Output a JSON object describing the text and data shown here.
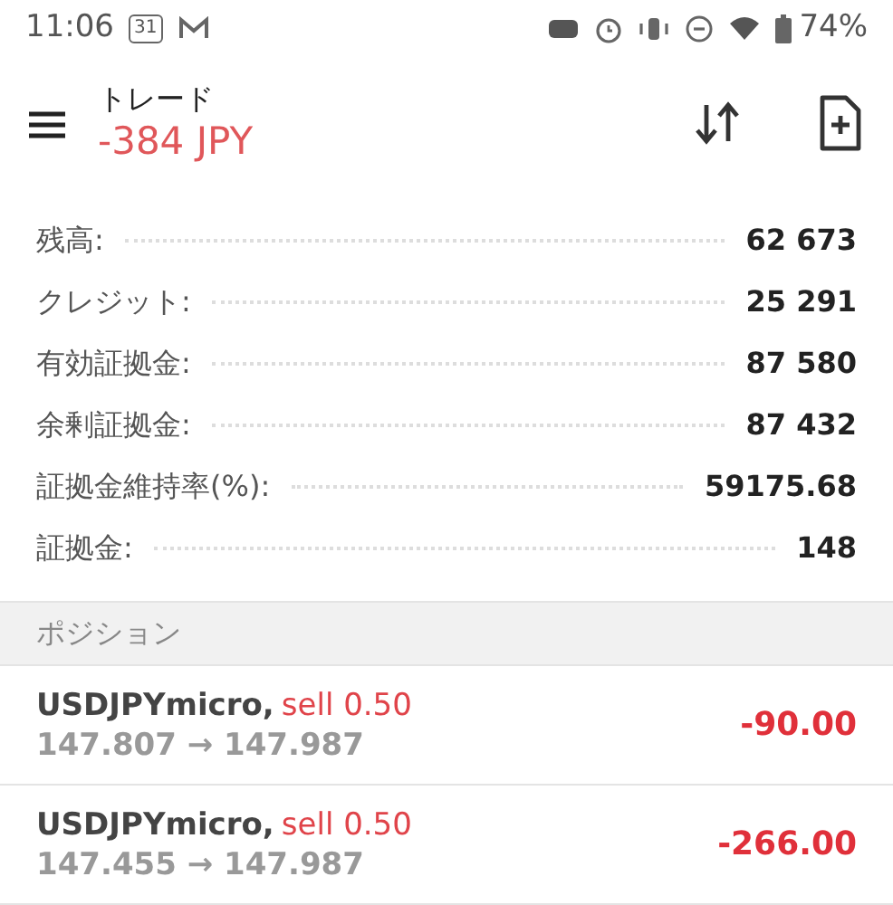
{
  "status_bar": {
    "time": "11:06",
    "calendar_day": "31",
    "battery": "74%"
  },
  "toolbar": {
    "title": "トレード",
    "profit": "-384 JPY"
  },
  "summary": [
    {
      "label": "残高:",
      "value": "62 673"
    },
    {
      "label": "クレジット:",
      "value": "25 291"
    },
    {
      "label": "有効証拠金:",
      "value": "87 580"
    },
    {
      "label": "余剰証拠金:",
      "value": "87 432"
    },
    {
      "label": "証拠金維持率(%):",
      "value": "59175.68"
    },
    {
      "label": "証拠金:",
      "value": "148"
    }
  ],
  "section_header": "ポジション",
  "positions": [
    {
      "symbol": "USDJPYmicro,",
      "order": "sell 0.50",
      "prices": "147.807 → 147.987",
      "profit": "-90.00"
    },
    {
      "symbol": "USDJPYmicro,",
      "order": "sell 0.50",
      "prices": "147.455 → 147.987",
      "profit": "-266.00"
    }
  ]
}
